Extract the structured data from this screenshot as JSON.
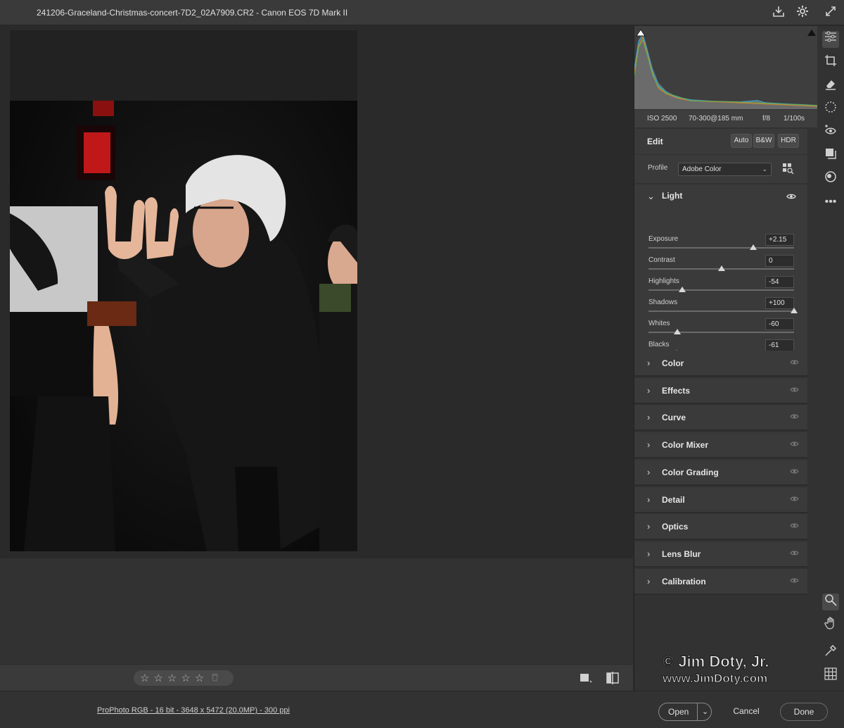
{
  "window": {
    "title": "241206-Graceland-Christmas-concert-7D2_02A7909.CR2  -  Canon EOS 7D Mark II"
  },
  "exif": {
    "iso": "ISO 2500",
    "lens": "70-300@185 mm",
    "aperture": "f/8",
    "shutter": "1/100s"
  },
  "edit": {
    "title": "Edit",
    "auto": "Auto",
    "bw": "B&W",
    "hdr": "HDR"
  },
  "profile": {
    "label": "Profile",
    "value": "Adobe Color"
  },
  "light": {
    "title": "Light",
    "sliders": [
      {
        "label": "Exposure",
        "value": "+2.15",
        "position": 0.72
      },
      {
        "label": "Contrast",
        "value": "0",
        "position": 0.5
      },
      {
        "label": "Highlights",
        "value": "-54",
        "position": 0.23
      },
      {
        "label": "Shadows",
        "value": "+100",
        "position": 1.0
      },
      {
        "label": "Whites",
        "value": "-60",
        "position": 0.2
      },
      {
        "label": "Blacks",
        "value": "-61",
        "position": 0.195
      }
    ]
  },
  "sections": [
    "Color",
    "Effects",
    "Curve",
    "Color Mixer",
    "Color Grading",
    "Detail",
    "Optics",
    "Lens Blur",
    "Calibration"
  ],
  "rating": {
    "stars": 0,
    "max": 5
  },
  "footer": {
    "file_info": "ProPhoto RGB - 16 bit - 3648 x 5472 (20.0MP) - 300 ppi",
    "open": "Open",
    "cancel": "Cancel",
    "done": "Done"
  },
  "watermark": {
    "line1": "© Jim Doty, Jr.",
    "line2": "www.JimDoty.com"
  },
  "icons": {
    "top": [
      "save-download-icon",
      "gear-icon",
      "fullscreen-icon"
    ],
    "tools": [
      "edit-sliders-icon",
      "crop-icon",
      "eraser-icon",
      "masking-icon",
      "red-eye-icon",
      "presets-icon",
      "snapshots-icon",
      "more-icon",
      "zoom-icon",
      "hand-icon",
      "color-sampler-icon",
      "grid-icon"
    ]
  }
}
